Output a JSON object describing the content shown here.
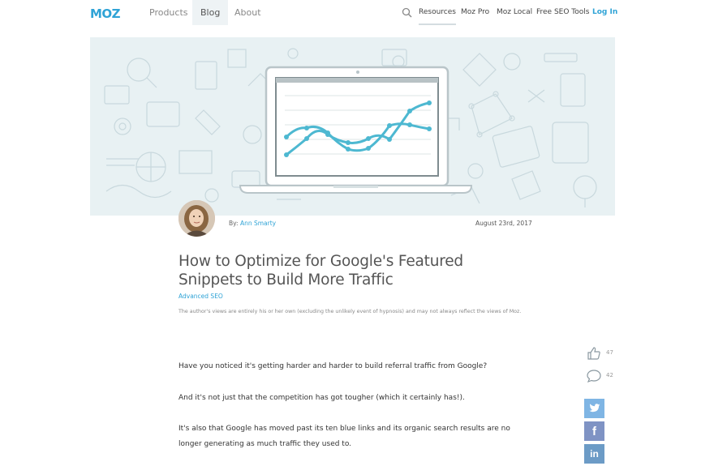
{
  "nav": {
    "logo": "MOZ",
    "links": [
      "Products",
      "Blog",
      "About"
    ],
    "right_links": [
      "Resources",
      "Moz Pro",
      "Moz Local",
      "Free SEO Tools"
    ],
    "login": "Log In"
  },
  "article": {
    "byline_prefix": "By:",
    "author": "Ann Smarty",
    "date": "August 23rd, 2017",
    "title_line1": "How to Optimize for Google's Featured",
    "title_line2": "Snippets to Build More Traffic",
    "category": "Advanced SEO",
    "disclaimer": "The author's views are entirely his or her own (excluding the unlikely event of hypnosis) and may not always reflect the views of Moz.",
    "paragraphs": [
      "Have you noticed it's getting harder and harder to build referral traffic from Google?",
      "And it's not just that the competition has got tougher (which it certainly has!).",
      "It's also that Google has moved past its ten blue links and its organic search results are no longer generating as much traffic they used to."
    ]
  },
  "side": {
    "likes": "47",
    "comments": "42"
  },
  "colors": {
    "brand": "#2fa3d6",
    "hero_bg": "#e8f1f3",
    "twitter": "#7fb5e4",
    "facebook": "#7f93c4",
    "linkedin": "#6c9bc6"
  }
}
